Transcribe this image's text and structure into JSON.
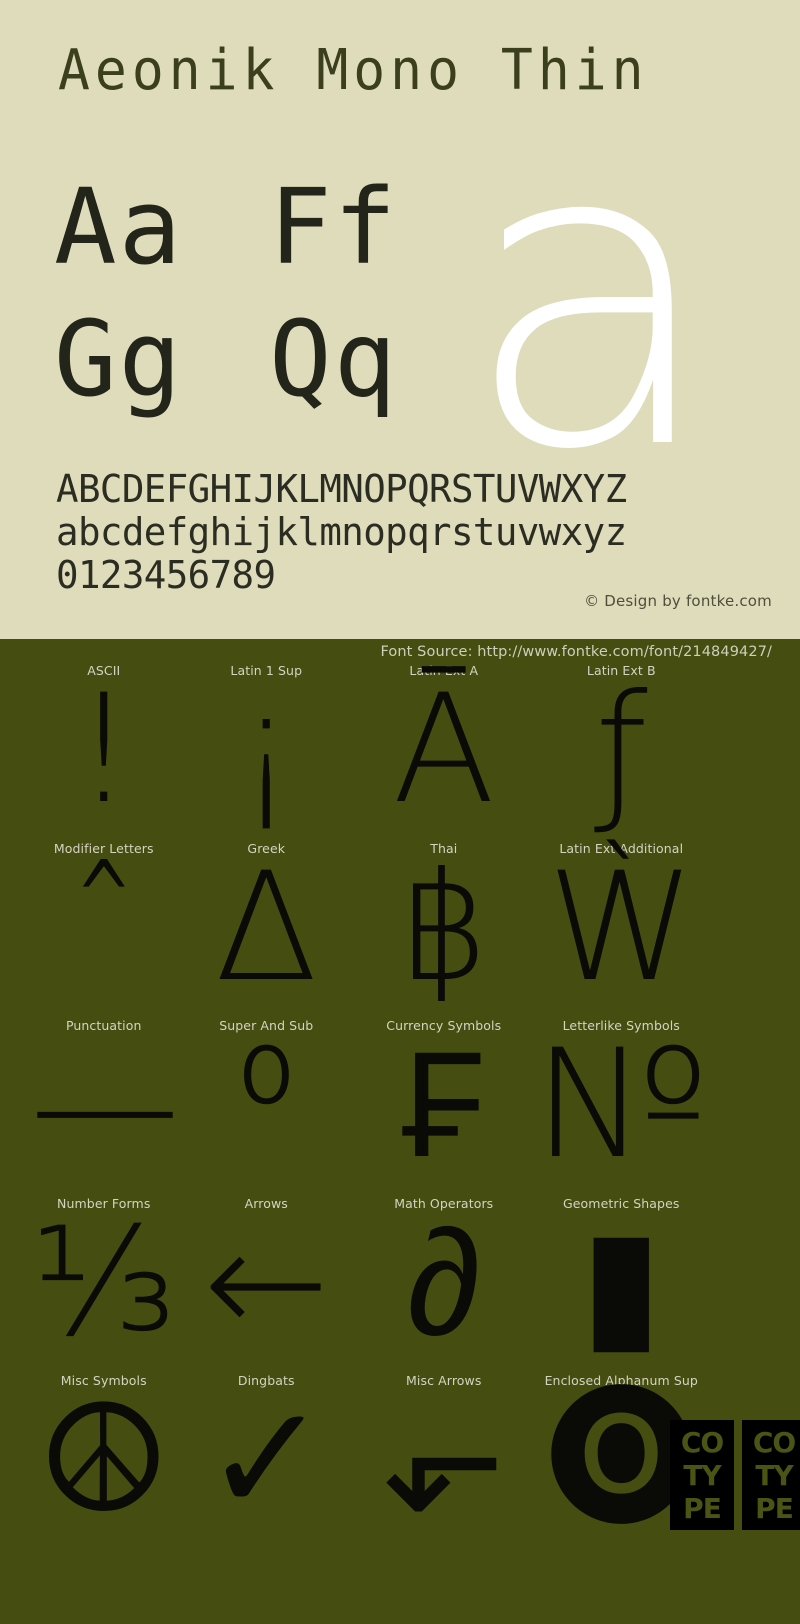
{
  "specimen": {
    "title": "Aeonik Mono Thin",
    "hero_glyph": "a",
    "sample_pairs": [
      [
        "Aa",
        "Ff"
      ],
      [
        "Gg",
        "Qq"
      ]
    ],
    "alphabet_uppercase": "ABCDEFGHIJKLMNOPQRSTUVWXYZ",
    "alphabet_lowercase": "abcdefghijklmnopqrstuvwxyz",
    "digits": "0123456789",
    "design_credit": "© Design by fontke.com",
    "background_color": "#dfdcbb",
    "text_color": "#23241a",
    "hero_color": "#ffffff"
  },
  "blocks_section": {
    "font_source": "Font Source: http://www.fontke.com/font/214849427/",
    "background_color": "#454d11",
    "label_color": "#d5d3c2",
    "glyph_color": "#0a0a06",
    "blocks": [
      {
        "label": "ASCII",
        "glyph": "!"
      },
      {
        "label": "Latin 1 Sup",
        "glyph": "¡"
      },
      {
        "label": "Latin Ext A",
        "glyph": "Ā"
      },
      {
        "label": "Latin Ext B",
        "glyph": "ƒ"
      },
      {
        "label": "Modifier Letters",
        "glyph": "ˆ"
      },
      {
        "label": "Greek",
        "glyph": "Δ"
      },
      {
        "label": "Thai",
        "glyph": "฿"
      },
      {
        "label": "Latin Ext Additional",
        "glyph": "Ẁ"
      },
      {
        "label": "Punctuation",
        "glyph": "—"
      },
      {
        "label": "Super And Sub",
        "glyph": "⁰"
      },
      {
        "label": "Currency Symbols",
        "glyph": "₣"
      },
      {
        "label": "Letterlike Symbols",
        "glyph": "№"
      },
      {
        "label": "Number Forms",
        "glyph": "⅓"
      },
      {
        "label": "Arrows",
        "glyph": "←"
      },
      {
        "label": "Math Operators",
        "glyph": "∂"
      },
      {
        "label": "Geometric Shapes",
        "glyph": "▮"
      },
      {
        "label": "Misc Symbols",
        "glyph": "☮"
      },
      {
        "label": "Dingbats",
        "glyph": "✓"
      },
      {
        "label": "Misc Arrows",
        "glyph": "⬐"
      },
      {
        "label": "Enclosed Alphanum Sup",
        "glyph": "🅞"
      }
    ],
    "cotype_tiles": [
      {
        "line1": "CO",
        "line2": "TY",
        "line3": "PE"
      },
      {
        "line1": "CO",
        "line2": "TY",
        "line3": "PE"
      }
    ]
  }
}
